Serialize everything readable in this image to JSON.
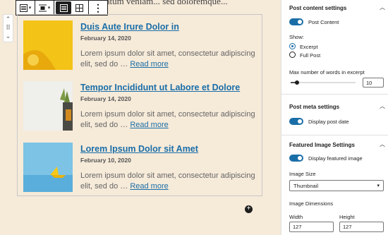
{
  "canvas": {
    "background_text": "...atum veniam... sed doloremque...",
    "toolbar": {
      "icons": [
        "list-view-icon",
        "align-icon",
        "list-layout-icon",
        "grid-layout-icon",
        "more-options-icon"
      ]
    },
    "posts": [
      {
        "title": "Duis Aute Irure Dolor in",
        "date": "February 14, 2020",
        "excerpt": "Lorem ipsum dolor sit amet, consectetur adipiscing elit, sed do … ",
        "read_more": "Read more",
        "thumb": "yellow"
      },
      {
        "title": "Tempor Incididunt ut Labore et Dolore",
        "date": "February 14, 2020",
        "excerpt": "Lorem ipsum dolor sit amet, consectetur adipiscing elit, sed do … ",
        "read_more": "Read more",
        "thumb": "plant"
      },
      {
        "title": "Lorem Ipsum Dolor sit Amet",
        "date": "February 10, 2020",
        "excerpt": "Lorem ipsum dolor sit amet, consectetur adipiscing elit, sed do … ",
        "read_more": "Read more",
        "thumb": "boat"
      }
    ]
  },
  "sidebar": {
    "post_content_settings": {
      "title": "Post content settings",
      "toggle_label": "Post Content",
      "show_label": "Show:",
      "options": [
        "Excerpt",
        "Full Post"
      ],
      "selected": "Excerpt",
      "max_words_label": "Max number of words in excerpt",
      "max_words_value": "10",
      "max_words_fraction": 0.1
    },
    "post_meta_settings": {
      "title": "Post meta settings",
      "toggle_label": "Display post date"
    },
    "featured_image_settings": {
      "title": "Featured Image Settings",
      "toggle_label": "Display featured image",
      "image_size_label": "Image Size",
      "image_size_value": "Thumbnail",
      "dimensions_label": "Image Dimensions",
      "width_label": "Width",
      "height_label": "Height",
      "width_value": "127",
      "height_value": "127"
    }
  },
  "colors": {
    "accent": "#1a6ea8",
    "canvas_bg": "#f6ead9"
  }
}
